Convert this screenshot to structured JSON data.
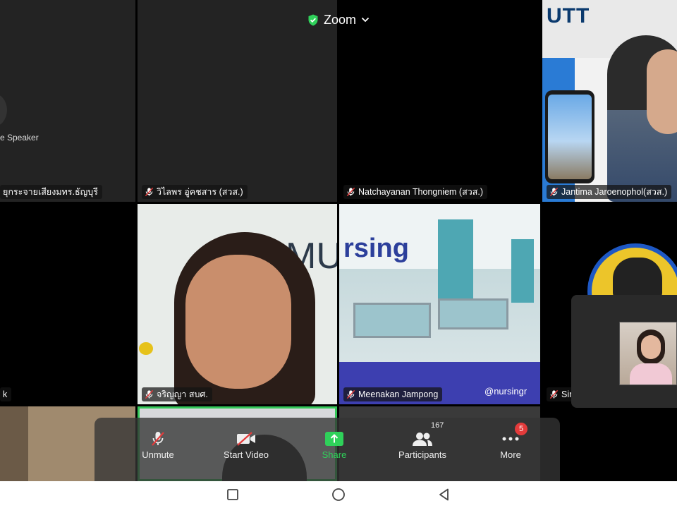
{
  "header": {
    "title": "Zoom"
  },
  "tiles": {
    "t1": {
      "label": "e Speaker",
      "name": "ยุกระจายเสียงมทร.ธัญบุรี"
    },
    "t2": {
      "name": "วิไลพร  อู่คชสาร (สวส.)"
    },
    "t3": {
      "name": "Natchayanan Thongniem (สวส.)"
    },
    "t4": {
      "name": "Jantima Jaroenophol(สวส.)",
      "logo": "UTT"
    },
    "t5": {
      "name": "k"
    },
    "t6": {
      "name": "จริญญา สบศ.",
      "backdrop": "MU"
    },
    "t7": {
      "name": "Meenakan Jampong",
      "banner": "rsing",
      "handle": "@nursingr"
    },
    "t8": {
      "name": "Sir"
    }
  },
  "toolbar": {
    "unmute": "Unmute",
    "start_video": "Start Video",
    "share": "Share",
    "participants": "Participants",
    "participants_count": "167",
    "more": "More",
    "more_badge": "5"
  },
  "colors": {
    "active_speaker": "#35c759",
    "share": "#2fd15a",
    "badge": "#e43b3b"
  }
}
